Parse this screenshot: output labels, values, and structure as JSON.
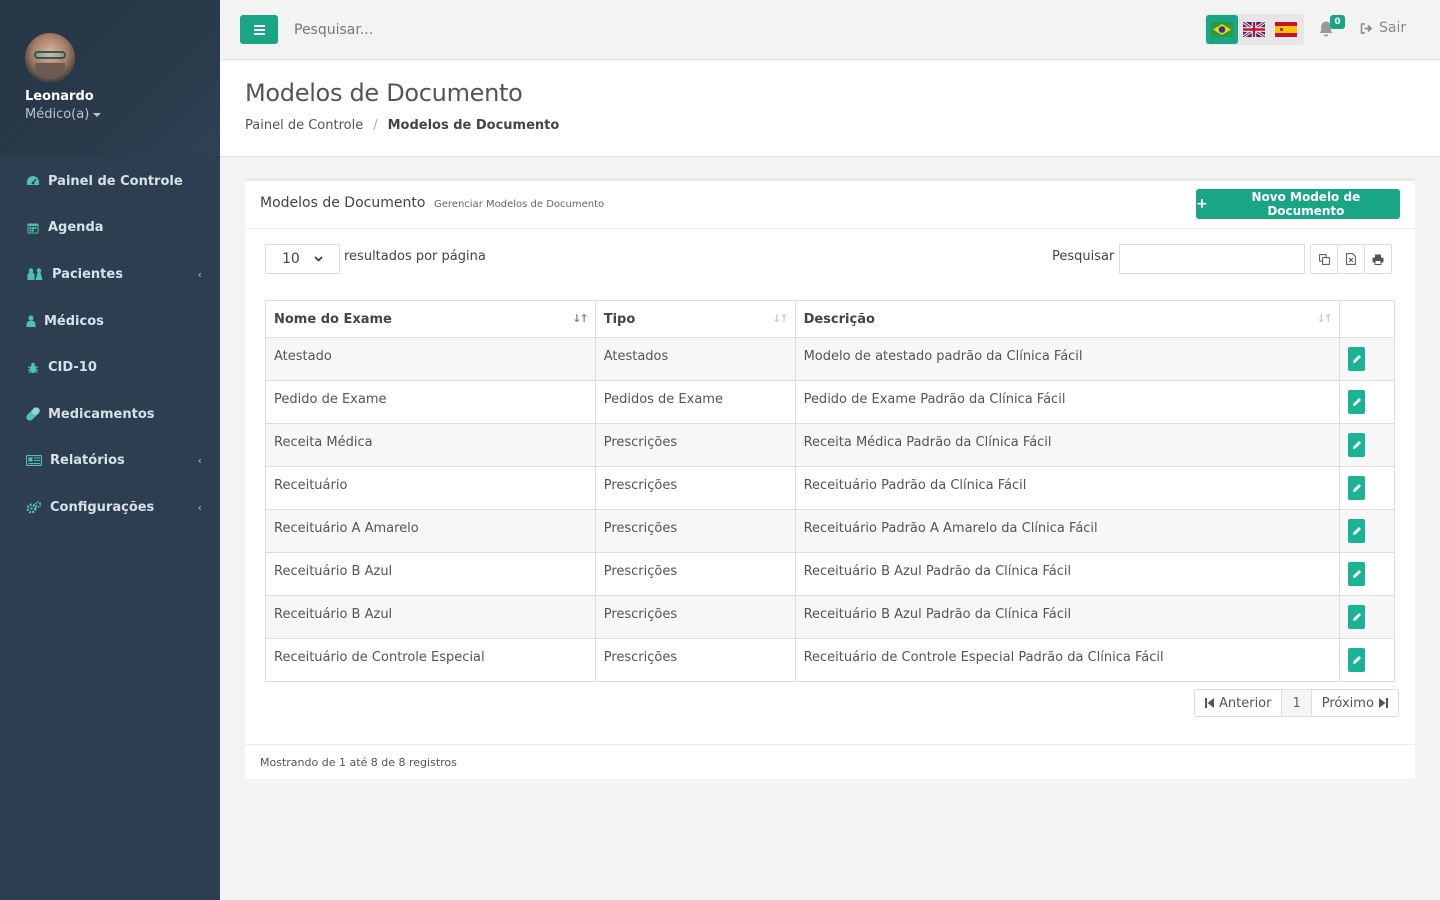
{
  "user": {
    "name": "Leonardo",
    "role": "Médico(a)"
  },
  "sidebar": {
    "items": [
      {
        "label": "Painel de Controle",
        "icon": "dashboard-icon",
        "has_children": false
      },
      {
        "label": "Agenda",
        "icon": "calendar-icon",
        "has_children": false
      },
      {
        "label": "Pacientes",
        "icon": "users-icon",
        "has_children": true
      },
      {
        "label": "Médicos",
        "icon": "user-md-icon",
        "has_children": false
      },
      {
        "label": "CID-10",
        "icon": "bug-icon",
        "has_children": false
      },
      {
        "label": "Medicamentos",
        "icon": "pill-icon",
        "has_children": false
      },
      {
        "label": "Relatórios",
        "icon": "report-icon",
        "has_children": true
      },
      {
        "label": "Configurações",
        "icon": "cogs-icon",
        "has_children": true
      }
    ]
  },
  "topbar": {
    "search_placeholder": "Pesquisar...",
    "notifications_count": "0",
    "logout_label": "Sair",
    "languages": [
      "pt-BR",
      "en-GB",
      "es-ES"
    ],
    "active_language": "pt-BR"
  },
  "page": {
    "title": "Modelos de Documento",
    "breadcrumb": [
      "Painel de Controle",
      "Modelos de Documento"
    ]
  },
  "box": {
    "title": "Modelos de Documento",
    "subtitle": "Gerenciar Modelos de Documento",
    "new_button": "Novo Modelo de Documento"
  },
  "table_controls": {
    "page_size": "10",
    "page_size_label": "resultados por página",
    "search_label": "Pesquisar"
  },
  "table": {
    "columns": [
      "Nome do Exame",
      "Tipo",
      "Descrição",
      ""
    ],
    "rows": [
      [
        "Atestado",
        "Atestados",
        "Modelo de atestado padrão da Clínica Fácil"
      ],
      [
        "Pedido de Exame",
        "Pedidos de Exame",
        "Pedido de Exame Padrão da Clínica Fácil"
      ],
      [
        "Receita Médica",
        "Prescrições",
        "Receita Médica Padrão da Clínica Fácil"
      ],
      [
        "Receituário",
        "Prescrições",
        "Receituário Padrão da Clínica Fácil"
      ],
      [
        "Receituário A Amarelo",
        "Prescrições",
        "Receituário Padrão A Amarelo da Clínica Fácil"
      ],
      [
        "Receituário B Azul",
        "Prescrições",
        "Receituário B Azul Padrão da Clínica Fácil"
      ],
      [
        "Receituário B Azul",
        "Prescrições",
        "Receituário B Azul Padrão da Clínica Fácil"
      ],
      [
        "Receituário de Controle Especial",
        "Prescrições",
        "Receituário de Controle Especial Padrão da Clínica Fácil"
      ]
    ]
  },
  "pagination": {
    "prev": "Anterior",
    "current": "1",
    "next": "Próximo"
  },
  "footer": {
    "info": "Mostrando de 1 até 8 de 8 registros"
  },
  "colors": {
    "accent": "#1aa685",
    "sidebar": "#2c3e50",
    "icon": "#4fc1b1"
  }
}
